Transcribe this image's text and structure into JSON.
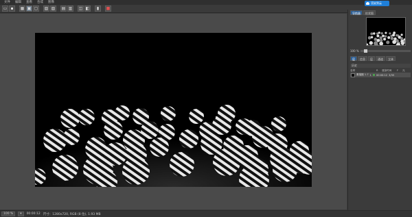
{
  "menu": [
    "文件",
    "编辑",
    "查看",
    "合成",
    "图像"
  ],
  "toolbar": {
    "icons": [
      "folder-open-icon",
      "save-icon",
      "sep",
      "grid-icon",
      "frame-icon",
      "frame2-icon",
      "sep",
      "image-icon",
      "image2-icon",
      "sep",
      "film-icon",
      "film2-icon",
      "sep",
      "snapshot-icon",
      "render-icon",
      "sep",
      "video-icon",
      "sep",
      "stop-icon"
    ]
  },
  "cloud": {
    "label": "渲染到云"
  },
  "panel": {
    "tabs": [
      "导航器",
      "柱状图"
    ],
    "zoom": "100 %",
    "tabs2": [
      "层",
      "信息",
      "层",
      "通道",
      "立体"
    ],
    "layers_title": "历史",
    "layers_header": [
      "名称",
      "R",
      "渲染时间",
      "F",
      "元"
    ],
    "layer": {
      "name": "素描圈 1.7",
      "time": "00:00:12",
      "frame": "3/35",
      "r": "1"
    }
  },
  "status": {
    "zoom": "100 %",
    "time": "00:00:12",
    "size_label": "尺寸：1280x720, RGB (8 位), 1.93 MB"
  },
  "colors": {
    "accent": "#1f7fd8",
    "layer_active": "#4caf50"
  }
}
